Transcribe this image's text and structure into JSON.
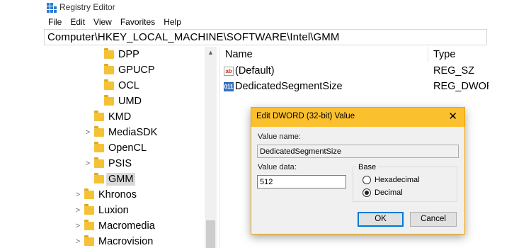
{
  "window": {
    "title": "Registry Editor",
    "icon": "registry-editor-icon"
  },
  "menu": [
    "File",
    "Edit",
    "View",
    "Favorites",
    "Help"
  ],
  "address": "Computer\\HKEY_LOCAL_MACHINE\\SOFTWARE\\Intel\\GMM",
  "tree": {
    "items": [
      {
        "label": "DPP",
        "expander": ""
      },
      {
        "label": "GPUCP",
        "expander": ""
      },
      {
        "label": "OCL",
        "expander": ""
      },
      {
        "label": "UMD",
        "expander": ""
      },
      {
        "label": "KMD",
        "expander": ""
      },
      {
        "label": "MediaSDK",
        "expander": ">"
      },
      {
        "label": "OpenCL",
        "expander": ""
      },
      {
        "label": "PSIS",
        "expander": ">"
      },
      {
        "label": "GMM",
        "expander": "",
        "selected": true
      },
      {
        "label": "Khronos",
        "expander": ">"
      },
      {
        "label": "Luxion",
        "expander": ">"
      },
      {
        "label": "Macromedia",
        "expander": ">"
      },
      {
        "label": "Macrovision",
        "expander": ">"
      }
    ]
  },
  "list": {
    "headers": {
      "name": "Name",
      "type": "Type"
    },
    "rows": [
      {
        "icon": "string-value-icon",
        "icon_text": "ab",
        "name": "(Default)",
        "type": "REG_SZ"
      },
      {
        "icon": "binary-value-icon",
        "icon_text": "011",
        "name": "DedicatedSegmentSize",
        "type": "REG_DWOR"
      }
    ]
  },
  "dialog": {
    "title": "Edit DWORD (32-bit) Value",
    "close_glyph": "✕",
    "value_name_label": "Value name:",
    "value_name": "DedicatedSegmentSize",
    "value_data_label": "Value data:",
    "value_data": "512",
    "base_label": "Base",
    "base_options": [
      {
        "label": "Hexadecimal",
        "checked": false
      },
      {
        "label": "Decimal",
        "checked": true
      }
    ],
    "ok_label": "OK",
    "cancel_label": "Cancel"
  },
  "colors": {
    "dialog_titlebar": "#fbc02d",
    "folder": "#f5c236",
    "selection": "#d9d9d9",
    "default_button_border": "#0078d7"
  }
}
